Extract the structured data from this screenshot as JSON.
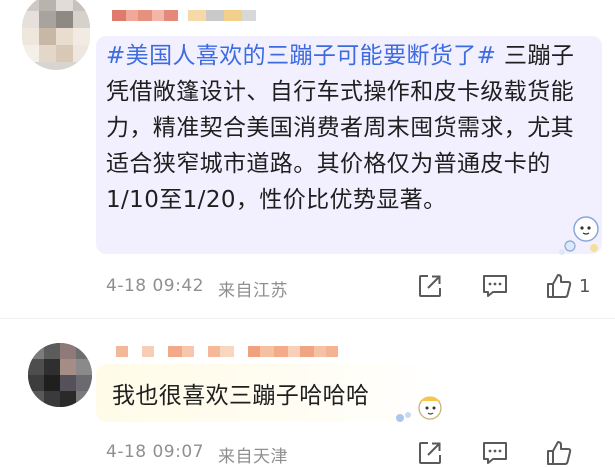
{
  "colors": {
    "topic": "#3d6ce0",
    "bubble_purple": "#f2f0ff",
    "bubble_yellow": "#fffbe8",
    "meta": "#8f8f8f"
  },
  "comments": [
    {
      "topic": "#美国人喜欢的三蹦子可能要断货了#",
      "body": " 三蹦子凭借敞篷设计、自行车式操作和皮卡级载货能力，精准契合美国消费者周末囤货需求，尤其适合狭窄城市道路。其价格仅为普通皮卡的1/10至1/20，性价比优势显著。",
      "timestamp": "4-18 09:42",
      "location": "来自江苏",
      "like_count": "1",
      "actions": [
        "share-icon",
        "comment-icon",
        "like-icon"
      ]
    },
    {
      "body": "我也很喜欢三蹦子哈哈哈",
      "timestamp": "4-18 09:07",
      "location": "来自天津",
      "actions": [
        "share-icon",
        "comment-icon",
        "like-icon"
      ]
    }
  ]
}
